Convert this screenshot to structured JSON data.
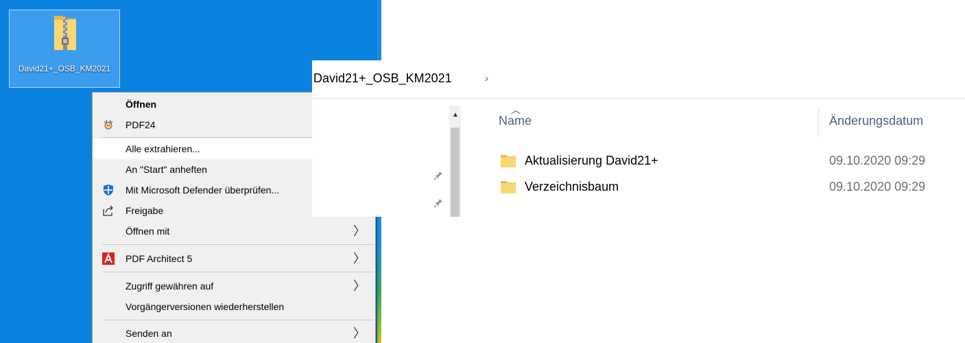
{
  "desktop": {
    "icon_label": "David21+_OSB_KM2021",
    "icon_name": "zip-folder-icon"
  },
  "context_menu": {
    "items": [
      {
        "label": "Öffnen",
        "icon": null,
        "bold": true,
        "submenu": false
      },
      {
        "label": "PDF24",
        "icon": "pdf24-icon",
        "bold": false,
        "submenu": false
      },
      {
        "label": "Alle extrahieren...",
        "icon": null,
        "bold": false,
        "submenu": false,
        "highlighted": true
      },
      {
        "label": "An \"Start\" anheften",
        "icon": null,
        "bold": false,
        "submenu": false
      },
      {
        "label": "Mit Microsoft Defender überprüfen...",
        "icon": "defender-shield-icon",
        "bold": false,
        "submenu": false
      },
      {
        "label": "Freigabe",
        "icon": "share-icon",
        "bold": false,
        "submenu": false
      },
      {
        "label": "Öffnen mit",
        "icon": null,
        "bold": false,
        "submenu": true
      },
      {
        "label": "PDF Architect 5",
        "icon": "pdf-architect-icon",
        "bold": false,
        "submenu": true
      },
      {
        "label": "Zugriff gewähren auf",
        "icon": null,
        "bold": false,
        "submenu": true
      },
      {
        "label": "Vorgängerversionen wiederherstellen",
        "icon": null,
        "bold": false,
        "submenu": false
      },
      {
        "label": "Senden an",
        "icon": null,
        "bold": false,
        "submenu": true
      }
    ]
  },
  "explorer": {
    "address": {
      "breadcrumb": "David21+_OSB_KM2021",
      "chevron": "›"
    },
    "columns": {
      "name": "Name",
      "date": "Änderungsdatum"
    },
    "rows": [
      {
        "name": "Aktualisierung David21+",
        "date": "09.10.2020 09:29"
      },
      {
        "name": "Verzeichnisbaum",
        "date": "09.10.2020 09:29"
      }
    ]
  },
  "colors": {
    "desktop_bg": "#0a82e0",
    "menu_bg": "#f0f0f0",
    "folder_yellow": "#f8d775"
  }
}
